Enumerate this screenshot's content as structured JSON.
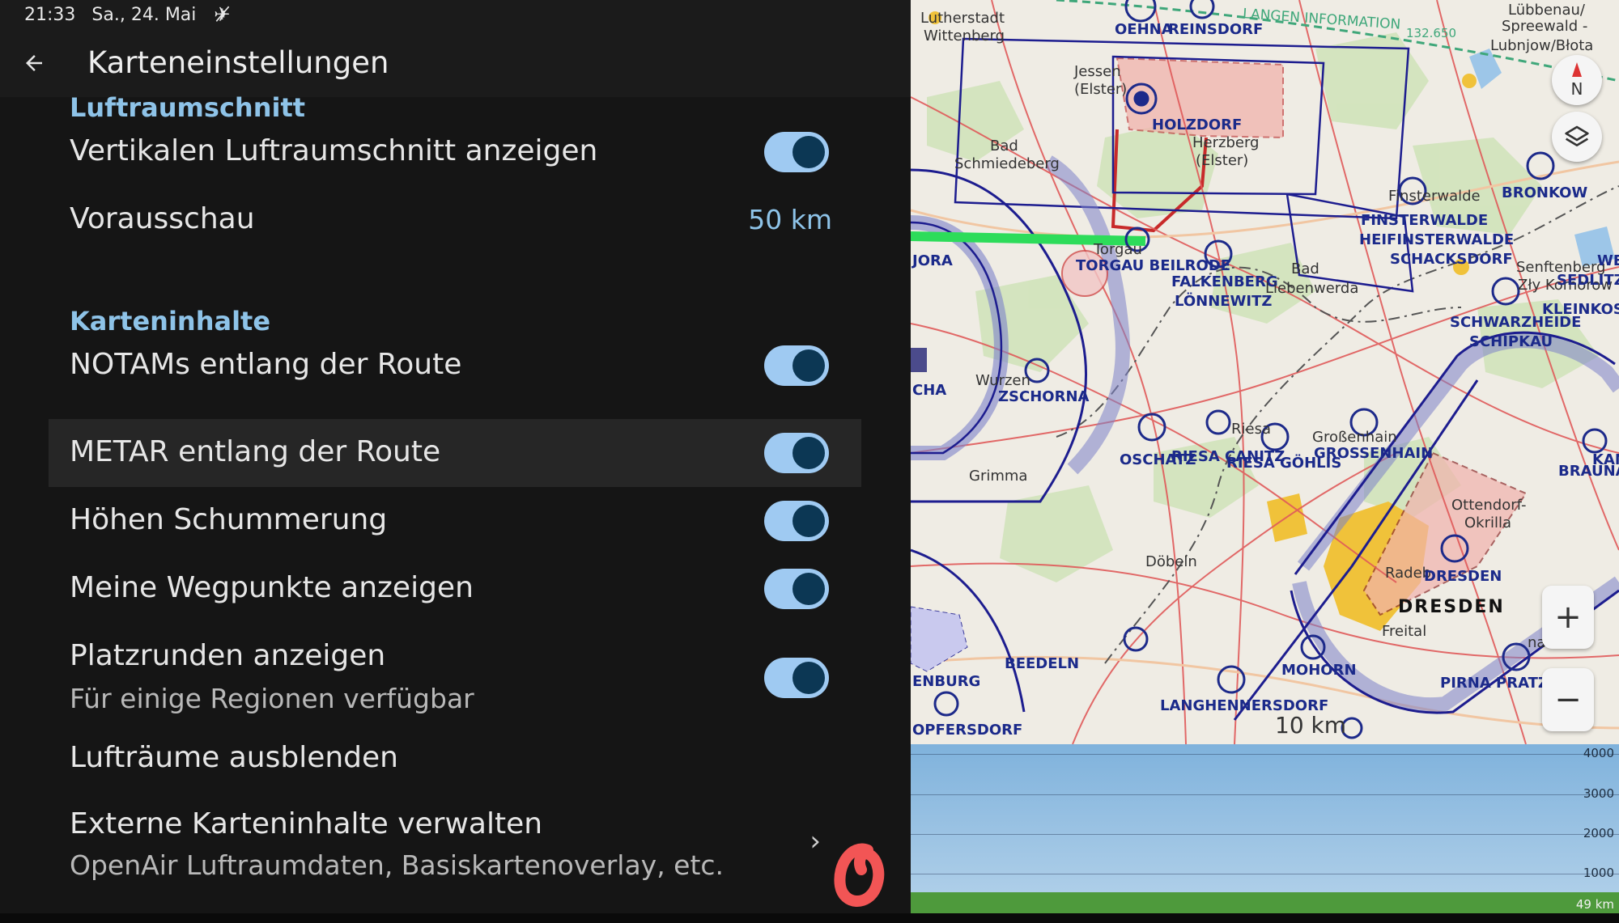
{
  "status_bar": {
    "time": "21:33",
    "date": "Sa., 24. Mai",
    "notification_icon": "satellite-off-icon"
  },
  "app_bar": {
    "title": "Karteneinstellungen",
    "back_icon": "arrow-back-icon"
  },
  "sections": {
    "airspace_section": {
      "header": "Luftraumschnitt",
      "vertical_cut": {
        "label": "Vertikalen Luftraumschnitt anzeigen",
        "on": true
      },
      "lookahead": {
        "label": "Vorausschau",
        "value": "50 km"
      }
    },
    "map_content_section": {
      "header": "Karteninhalte",
      "notams": {
        "label": "NOTAMs entlang der Route",
        "on": true
      },
      "metar": {
        "label": "METAR entlang der Route",
        "on": true
      },
      "hillshade": {
        "label": "Höhen Schummerung",
        "on": true
      },
      "waypoints": {
        "label": "Meine Wegpunkte anzeigen",
        "on": true
      },
      "traffic_patterns": {
        "label": "Platzrunden anzeigen",
        "sublabel": "Für einige Regionen verfügbar",
        "on": true
      },
      "hide_airspaces": {
        "label": "Lufträume ausblenden"
      },
      "external": {
        "label": "Externe Karteninhalte verwalten",
        "sublabel": "OpenAir Luftraumdaten, Basiskartenoverlay, etc."
      }
    }
  },
  "map": {
    "labels": {
      "lutherstadt": "Lutherstadt",
      "wittenberg": "Wittenberg",
      "oehna": "OEHNA",
      "reinsdorf": "REINSDORF",
      "langen_info": "LANGEN INFORMATION",
      "frequency": "132.650",
      "luebbenau": "Lübbenau/",
      "spreewald": "Spreewald -",
      "lubnjow": "Lubnjow/Błota",
      "jessen": "Jessen",
      "elster1": "(Elster)",
      "holzdorf": "HOLZDORF",
      "herzberg": "Herzberg",
      "elster2": "(Elster)",
      "bad1": "Bad",
      "schmiedeberg": "Schmiedeberg",
      "finsterwalde_town": "Finsterwalde",
      "finsterwalde": "FINSTERWALDE",
      "heiffinsterwalde": "HEIFINSTERWALDE",
      "schacksdorf": "SCHACKSDORF",
      "bronkow": "BRONKOW",
      "jora": "JORA",
      "torgau": "Torgau",
      "torgau_beilrode": "TORGAU BEILRODE",
      "falkenberg": "FALKENBERG",
      "loennewitz": "LÖNNEWITZ",
      "bad2": "Bad",
      "liebenwerda": "Liebenwerda",
      "senftenberg": "Senftenberg",
      "zly_komorow": "Zły Komorow",
      "sedlitz": "SEDLITZER",
      "wel": "WEL",
      "schwarzheide": "SCHWARZHEIDE",
      "schipkau": "SCHIPKAU",
      "kleinkoschen": "KLEINKOSC",
      "cha": "CHA",
      "wurzen": "Wurzen",
      "zschorna": "ZSCHORNA",
      "oschatz": "OSCHATZ",
      "riesa": "Riesa",
      "riesa_canitz": "RIESA CANITZ",
      "riesa_goehlis": "RIESA GÖHLIS",
      "grossenhain_town": "Großenhain",
      "grossenhain": "GROSSENHAIN",
      "kam": "KAM",
      "brauna": "BRAUNA",
      "grimma": "Grimma",
      "ottendorf1": "Ottendorf-",
      "ottendorf2": "Okrilla",
      "doebeln": "Döbeln",
      "radeb": "Radeb",
      "dresden_ap": "DRESDEN",
      "dresden_city": "DRESDEN",
      "freital": "Freital",
      "beedeln": "BEEDELN",
      "mohorn": "MOHORN",
      "pirna": "PIRNA PRATZS",
      "na": "na",
      "langhennersdorf": "LANGHENNERSDORF",
      "enburg": "ENBURG",
      "pfersdorf": "OPFERSDORF"
    },
    "scale": "10 km",
    "compass_label": "N"
  },
  "profile": {
    "ticks": [
      "4000",
      "3000",
      "2000",
      "1000"
    ],
    "distance": "49 km"
  }
}
